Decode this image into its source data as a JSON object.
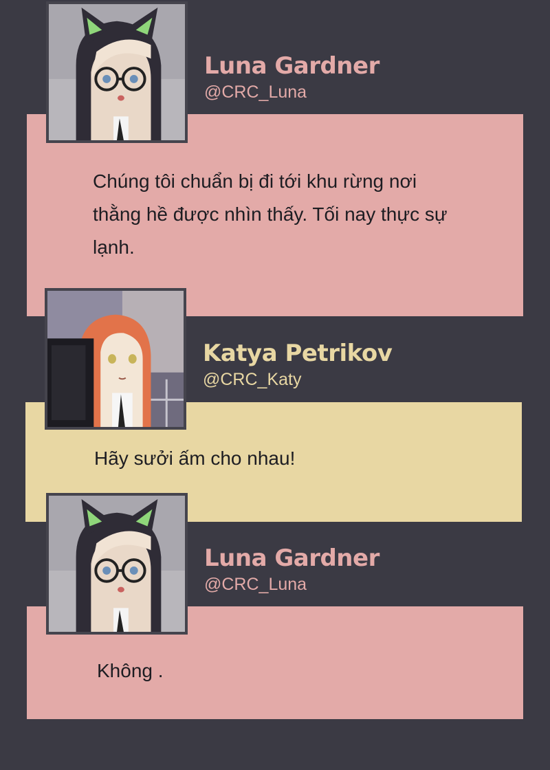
{
  "messages": [
    {
      "name": "Luna Gardner",
      "handle": "@CRC_Luna",
      "text_lines": [
        "Chúng tôi chuẩn bị đi tới khu rừng nơi",
        "thằng hề được nhìn thấy. Tối nay thực sự",
        "lạnh."
      ],
      "color": "#e3aaa8",
      "avatar": "luna-avatar"
    },
    {
      "name": "Katya Petrikov",
      "handle": "@CRC_Katy",
      "text_lines": [
        "Hãy sưởi ấm cho nhau!"
      ],
      "color": "#e8d7a3",
      "avatar": "katya-avatar"
    },
    {
      "name": "Luna Gardner",
      "handle": "@CRC_Luna",
      "text_lines": [
        "Không ."
      ],
      "color": "#e3aaa8",
      "avatar": "luna-avatar"
    }
  ],
  "colors": {
    "background": "#3b3a44",
    "pink": "#e3aaa8",
    "yellow": "#e8d7a3"
  }
}
